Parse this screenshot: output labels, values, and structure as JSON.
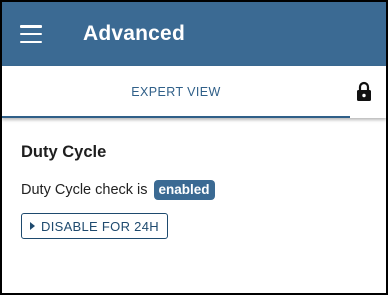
{
  "appbar": {
    "title": "Advanced",
    "menu_icon": "hamburger-menu-icon",
    "background": "#3b6a93"
  },
  "tabs": [
    {
      "label": "EXPERT VIEW",
      "selected": true
    }
  ],
  "tab_colors": {
    "label": "#2f5f88",
    "indicator": "#2f5f88"
  },
  "lock_icon": "lock-icon",
  "duty_cycle": {
    "title": "Duty Cycle",
    "status_text": "Duty Cycle check is",
    "status_badge": "enabled",
    "badge_color": "#3b6a93",
    "button_label": "DISABLE FOR 24H",
    "button_icon": "play-arrow-icon"
  }
}
